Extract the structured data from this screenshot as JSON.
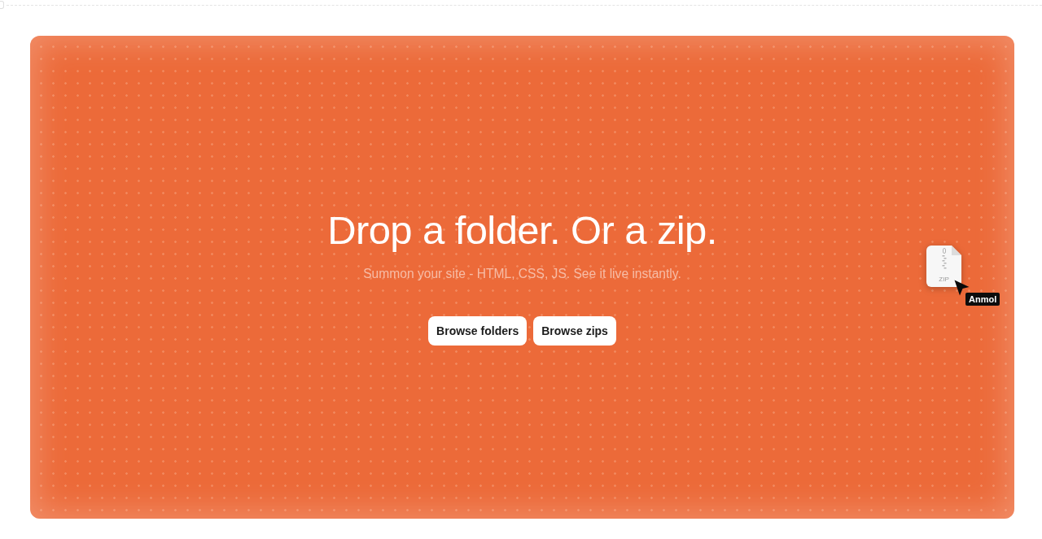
{
  "dropzone": {
    "title": "Drop a folder. Or a zip.",
    "subtitle": "Summon your site - HTML, CSS, JS. See it live instantly.",
    "buttons": [
      {
        "label": "Browse folders"
      },
      {
        "label": "Browse zips"
      }
    ]
  },
  "drag_preview": {
    "file_label": "ZIP",
    "cursor_label": "Anmol"
  }
}
